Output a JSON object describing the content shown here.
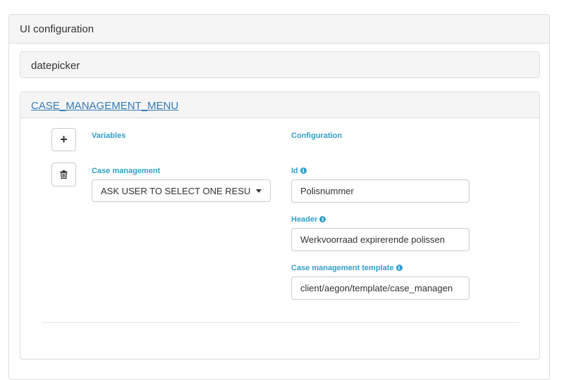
{
  "ui_configuration": {
    "title": "UI configuration"
  },
  "datepicker": {
    "title": "datepicker"
  },
  "case_management_menu": {
    "title": "CASE_MANAGEMENT_MENU",
    "add_button": "+",
    "variables_label": "Variables",
    "configuration_label": "Configuration",
    "case_management_label": "Case management",
    "case_management_select_value": "ASK USER TO SELECT ONE RESU",
    "id_label": "Id",
    "id_value": "Polisnummer",
    "header_label": "Header",
    "header_value": "Werkvoorraad expirerende polissen",
    "template_label": "Case management template",
    "template_value": "client/aegon/template/case_managen"
  },
  "colors": {
    "accent": "#31a0c9",
    "link": "#337ab7",
    "panel_bg": "#f5f5f5",
    "border": "#dddddd"
  },
  "icons": {
    "add": "plus-icon",
    "delete": "trash-icon",
    "info": "info-circle-icon",
    "dropdown": "caret-down-icon"
  }
}
